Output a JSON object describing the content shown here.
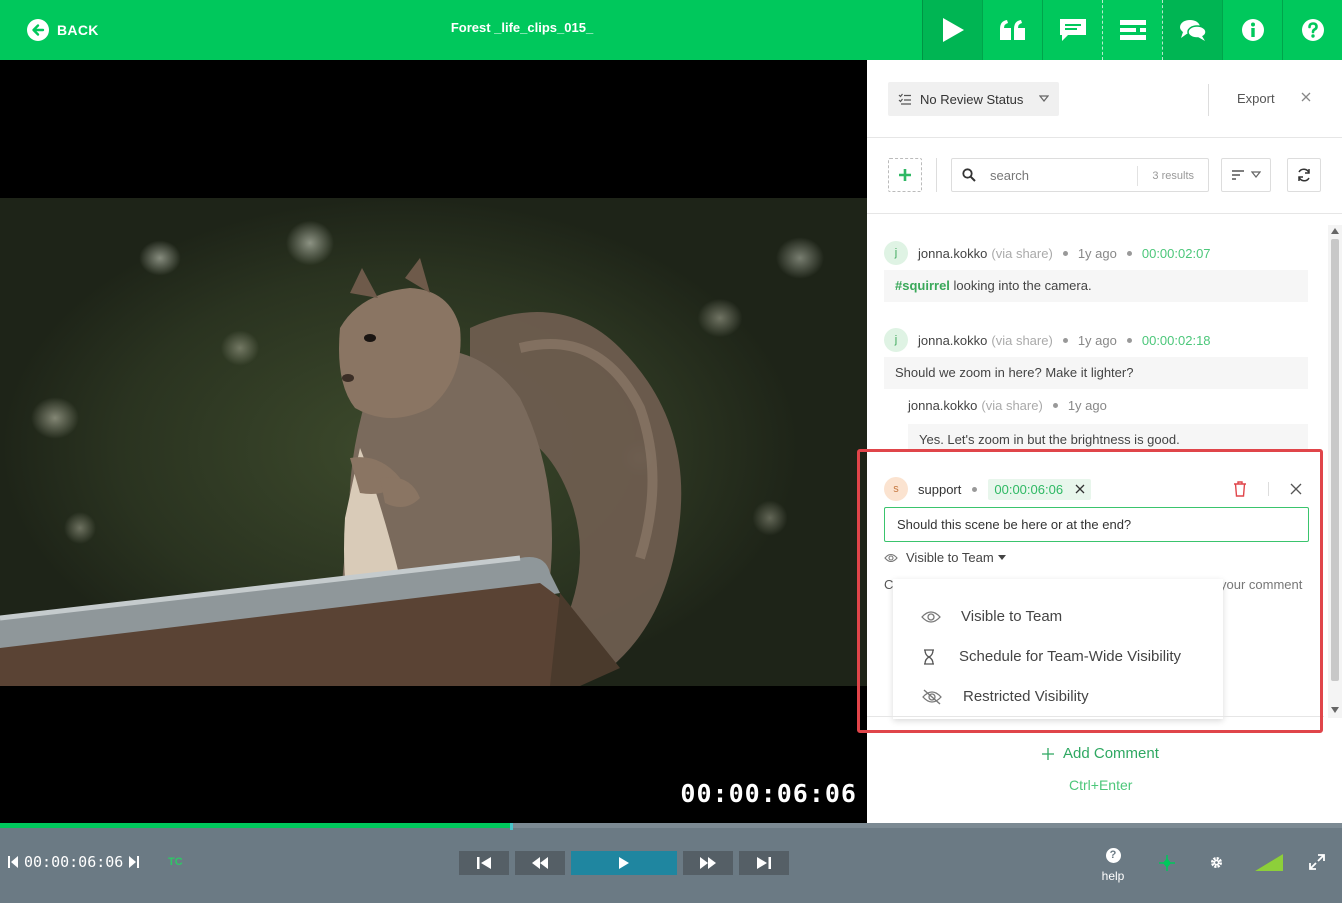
{
  "topbar": {
    "back_label": "BACK",
    "title": "Forest _life_clips_015_",
    "tools": [
      "play-icon",
      "quote-icon",
      "comment-icon",
      "list-icon",
      "chat-icon",
      "info-icon",
      "help-icon"
    ]
  },
  "video": {
    "timecode_overlay": "00:00:06:06"
  },
  "panel": {
    "review_status": "No Review Status",
    "export_label": "Export",
    "search": {
      "placeholder": "search",
      "results": "3 results"
    },
    "comments": [
      {
        "avatar": "j",
        "user": "jonna.kokko",
        "via": "(via share)",
        "ago": "1y ago",
        "timecode": "00:00:02:07",
        "tag": "#squirrel",
        "text": " looking into the camera."
      },
      {
        "avatar": "j",
        "user": "jonna.kokko",
        "via": "(via share)",
        "ago": "1y ago",
        "timecode": "00:00:02:18",
        "text": "Should we zoom in here? Make it lighter?",
        "reply": {
          "user": "jonna.kokko",
          "via": "(via share)",
          "ago": "1y ago",
          "text": "Yes. Let's zoom in but the brightness is good."
        }
      }
    ],
    "editor": {
      "avatar": "s",
      "user": "support",
      "timecode": "00:00:06:06",
      "value": "Should this scene be here or at the end?",
      "visibility": "Visible to Team",
      "under_left": "C",
      "under_right": "your comment",
      "visibility_options": [
        "Visible to Team",
        "Schedule for Team-Wide Visibility",
        "Restricted Visibility"
      ]
    },
    "add_comment_label": "Add Comment",
    "add_comment_shortcut": "Ctrl+Enter"
  },
  "player": {
    "timecode": "00:00:06:06",
    "tc_badge": "TC",
    "help_label": "help",
    "progress_fraction": 0.38
  },
  "colors": {
    "brand": "#00c85c",
    "highlight": "#e0454a",
    "bottombar": "#6b7a84"
  }
}
